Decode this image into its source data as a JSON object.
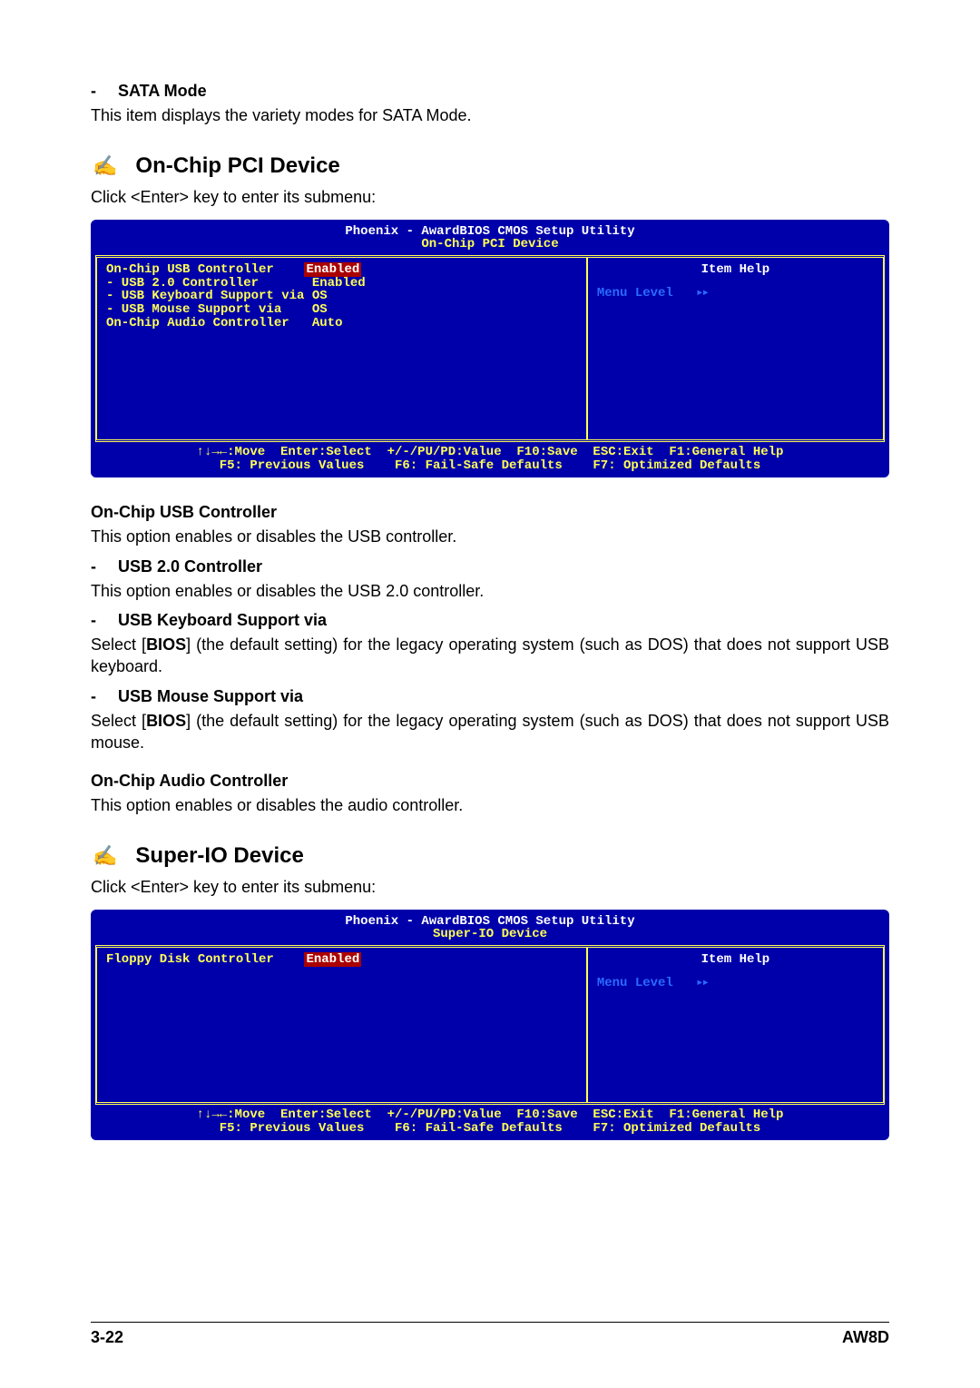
{
  "sata": {
    "heading": "SATA Mode",
    "desc": "This item displays the variety modes for SATA Mode."
  },
  "pci": {
    "heading": "On-Chip PCI Device",
    "intro": "Click <Enter> key to enter its submenu:"
  },
  "bios_pci": {
    "title_line1": "Phoenix - AwardBIOS CMOS Setup Utility",
    "title_line2": "On-Chip PCI Device",
    "row1_label": "On-Chip USB Controller",
    "row1_value": "Enabled",
    "row2_label": "- USB 2.0 Controller",
    "row2_value": "Enabled",
    "row3_label": "- USB Keyboard Support via",
    "row3_value": "OS",
    "row4_label": "- USB Mouse Support via",
    "row4_value": "OS",
    "row5_label": "On-Chip Audio Controller",
    "row5_value": "Auto",
    "item_help": "Item Help",
    "menu_level": "Menu Level",
    "footer1": "↑↓→←:Move  Enter:Select  +/-/PU/PD:Value  F10:Save  ESC:Exit  F1:General Help",
    "footer2": "  F5: Previous Values    F6: Fail-Safe Defaults    F7: Optimized Defaults  "
  },
  "usb_ctrl": {
    "heading": "On-Chip USB Controller",
    "desc": "This option enables or disables the USB controller."
  },
  "usb20": {
    "heading": "USB 2.0 Controller",
    "desc": "This option enables or disables the USB 2.0 controller."
  },
  "usb_kb": {
    "heading": "USB Keyboard Support via",
    "desc_pre": "Select [",
    "desc_bold": "BIOS",
    "desc_post": "] (the default setting) for the legacy operating system (such as DOS) that does not support USB keyboard."
  },
  "usb_mouse": {
    "heading": "USB Mouse Support via",
    "desc_pre": "Select [",
    "desc_bold": "BIOS",
    "desc_post": "] (the default setting) for the legacy operating system (such as DOS) that does not support USB mouse."
  },
  "audio": {
    "heading": "On-Chip Audio Controller",
    "desc": "This option enables or disables the audio controller."
  },
  "sio": {
    "heading": "Super-IO Device",
    "intro": "Click <Enter> key to enter its submenu:"
  },
  "bios_sio": {
    "title_line1": "Phoenix - AwardBIOS CMOS Setup Utility",
    "title_line2": "Super-IO Device",
    "row1_label": "Floppy Disk Controller",
    "row1_value": "Enabled",
    "item_help": "Item Help",
    "menu_level": "Menu Level",
    "footer1": "↑↓→←:Move  Enter:Select  +/-/PU/PD:Value  F10:Save  ESC:Exit  F1:General Help",
    "footer2": "  F5: Previous Values    F6: Fail-Safe Defaults    F7: Optimized Defaults  "
  },
  "footer": {
    "page": "3-22",
    "model": "AW8D"
  },
  "arrows": "▸▸"
}
